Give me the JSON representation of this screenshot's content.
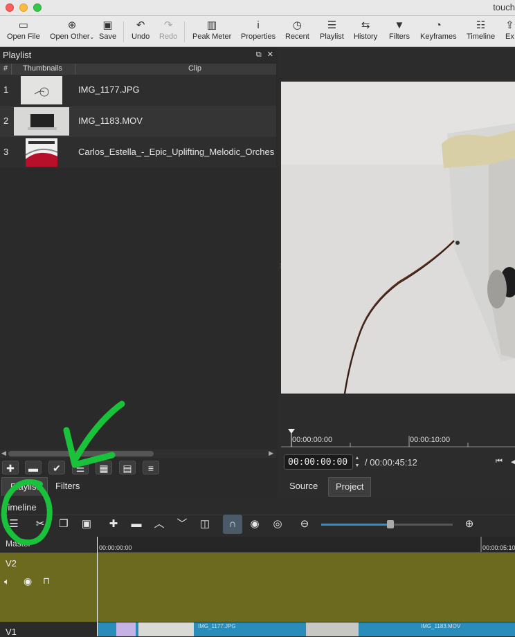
{
  "window": {
    "title": "touch"
  },
  "toolbar": {
    "items": [
      {
        "label": "Open File",
        "icon": "folder-icon"
      },
      {
        "label": "Open Other",
        "icon": "open-other-icon"
      },
      {
        "label": "Save",
        "icon": "save-icon"
      },
      {
        "label": "Undo",
        "icon": "undo-icon"
      },
      {
        "label": "Redo",
        "icon": "redo-icon"
      },
      {
        "label": "Peak Meter",
        "icon": "peak-meter-icon"
      },
      {
        "label": "Properties",
        "icon": "info-icon"
      },
      {
        "label": "Recent",
        "icon": "clock-icon"
      },
      {
        "label": "Playlist",
        "icon": "list-icon"
      },
      {
        "label": "History",
        "icon": "history-icon"
      },
      {
        "label": "Filters",
        "icon": "funnel-icon"
      },
      {
        "label": "Keyframes",
        "icon": "stopwatch-icon"
      },
      {
        "label": "Timeline",
        "icon": "timeline-icon"
      },
      {
        "label": "Ex",
        "icon": "export-icon"
      }
    ]
  },
  "playlist": {
    "title": "Playlist",
    "columns": [
      "#",
      "Thumbnails",
      "Clip"
    ],
    "rows": [
      {
        "num": "1",
        "clip": "IMG_1177.JPG"
      },
      {
        "num": "2",
        "clip": "IMG_1183.MOV"
      },
      {
        "num": "3",
        "clip": "Carlos_Estella_-_Epic_Uplifting_Melodic_Orches"
      }
    ],
    "tabs": [
      "Playlist",
      "Filters"
    ]
  },
  "viewer": {
    "ruler_labels": [
      "00:00:00:00",
      "00:00:10:00"
    ],
    "timecode": "00:00:00:00",
    "duration": "/ 00:00:45:12",
    "tabs": [
      "Source",
      "Project"
    ]
  },
  "timeline": {
    "title": "Timeline",
    "master_label": "Master",
    "ruler_labels": [
      "00:00:00:00",
      "00:00:05:10"
    ],
    "tracks": [
      {
        "name": "V2"
      },
      {
        "name": "V1"
      }
    ],
    "v1_clips": [
      "IMG_1177.JPG",
      "IMG_1183.MOV"
    ]
  },
  "colors": {
    "track_v2": "#6c6a1f",
    "clip_blue": "#2a8cb8",
    "annotation_green": "#19c23a"
  }
}
